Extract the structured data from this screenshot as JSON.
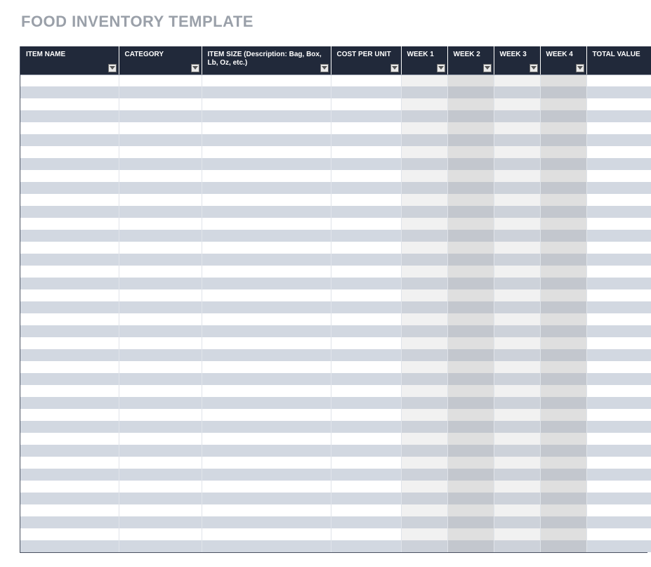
{
  "title": "FOOD INVENTORY  TEMPLATE",
  "columns": [
    {
      "key": "item_name",
      "label": "ITEM NAME",
      "class": "c-item",
      "week": false
    },
    {
      "key": "category",
      "label": "CATEGORY",
      "class": "c-cat",
      "week": false
    },
    {
      "key": "item_size",
      "label": "ITEM SIZE (Description: Bag, Box, Lb, Oz, etc.)",
      "class": "c-size",
      "week": false
    },
    {
      "key": "cost_per_unit",
      "label": "COST PER UNIT",
      "class": "c-cost",
      "week": false
    },
    {
      "key": "week1",
      "label": "WEEK 1",
      "class": "c-week",
      "week": true,
      "alt": false
    },
    {
      "key": "week2",
      "label": "WEEK 2",
      "class": "c-week",
      "week": true,
      "alt": true
    },
    {
      "key": "week3",
      "label": "WEEK 3",
      "class": "c-week",
      "week": true,
      "alt": false
    },
    {
      "key": "week4",
      "label": "WEEK 4",
      "class": "c-week",
      "week": true,
      "alt": true
    },
    {
      "key": "total_value",
      "label": "TOTAL VALUE",
      "class": "c-total",
      "week": false
    }
  ],
  "row_count": 40,
  "rows": []
}
